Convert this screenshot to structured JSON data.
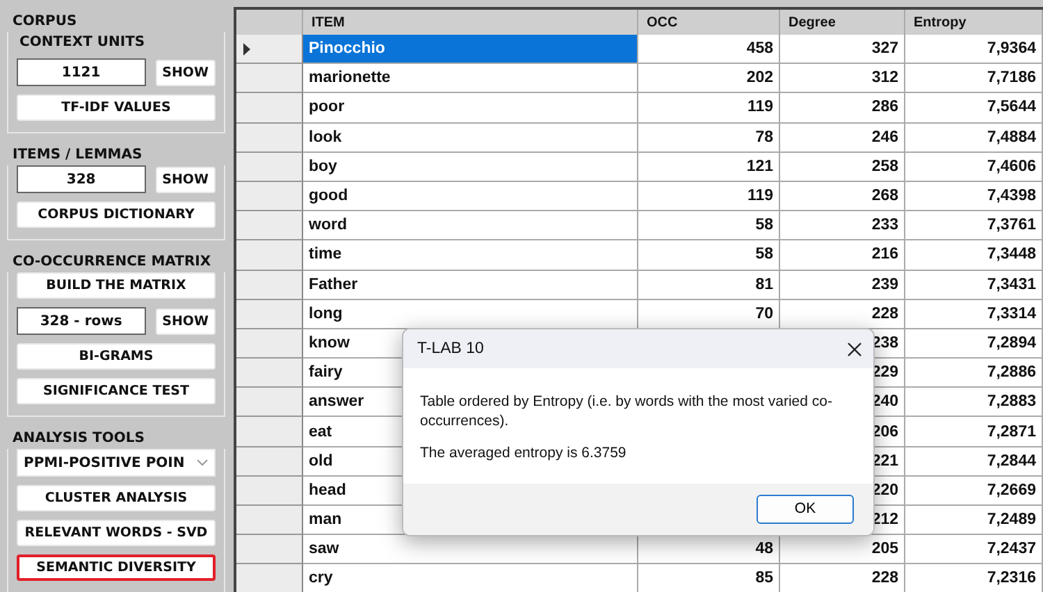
{
  "sidebar": {
    "sections": [
      {
        "title": "CORPUS",
        "controls": [
          {
            "kind": "label",
            "text": "CONTEXT UNITS"
          },
          {
            "kind": "field_show",
            "value": "1121",
            "button": "SHOW"
          },
          {
            "kind": "button",
            "label": "TF-IDF VALUES",
            "highlighted": false
          }
        ]
      },
      {
        "title": "ITEMS / LEMMAS",
        "controls": [
          {
            "kind": "field_show",
            "value": "328",
            "button": "SHOW"
          },
          {
            "kind": "button",
            "label": "CORPUS DICTIONARY",
            "highlighted": false
          }
        ]
      },
      {
        "title": "CO-OCCURRENCE MATRIX",
        "controls": [
          {
            "kind": "button",
            "label": "BUILD THE MATRIX",
            "highlighted": false
          },
          {
            "kind": "field_show",
            "value": "328 - rows",
            "button": "SHOW"
          },
          {
            "kind": "button",
            "label": "BI-GRAMS",
            "highlighted": false
          },
          {
            "kind": "button",
            "label": "SIGNIFICANCE TEST",
            "highlighted": false
          }
        ]
      },
      {
        "title": "ANALYSIS TOOLS",
        "controls": [
          {
            "kind": "select",
            "value": "PPMI-POSITIVE POIN"
          },
          {
            "kind": "button",
            "label": "CLUSTER ANALYSIS",
            "highlighted": false
          },
          {
            "kind": "button",
            "label": "RELEVANT WORDS - SVD",
            "highlighted": false
          },
          {
            "kind": "button",
            "label": "SEMANTIC DIVERSITY",
            "highlighted": true
          }
        ]
      }
    ]
  },
  "table": {
    "columns": [
      "ITEM",
      "OCC",
      "Degree",
      "Entropy"
    ],
    "rows": [
      {
        "item": "Pinocchio",
        "occ": "458",
        "degree": "327",
        "entropy": "7,9364",
        "selected": true
      },
      {
        "item": "marionette",
        "occ": "202",
        "degree": "312",
        "entropy": "7,7186",
        "selected": false
      },
      {
        "item": "poor",
        "occ": "119",
        "degree": "286",
        "entropy": "7,5644",
        "selected": false
      },
      {
        "item": "look",
        "occ": "78",
        "degree": "246",
        "entropy": "7,4884",
        "selected": false
      },
      {
        "item": "boy",
        "occ": "121",
        "degree": "258",
        "entropy": "7,4606",
        "selected": false
      },
      {
        "item": "good",
        "occ": "119",
        "degree": "268",
        "entropy": "7,4398",
        "selected": false
      },
      {
        "item": "word",
        "occ": "58",
        "degree": "233",
        "entropy": "7,3761",
        "selected": false
      },
      {
        "item": "time",
        "occ": "58",
        "degree": "216",
        "entropy": "7,3448",
        "selected": false
      },
      {
        "item": "Father",
        "occ": "81",
        "degree": "239",
        "entropy": "7,3431",
        "selected": false
      },
      {
        "item": "long",
        "occ": "70",
        "degree": "228",
        "entropy": "7,3314",
        "selected": false
      },
      {
        "item": "know",
        "degree": "238",
        "entropy": "7,2894",
        "selected": false
      },
      {
        "item": "fairy",
        "degree": "229",
        "entropy": "7,2886",
        "selected": false
      },
      {
        "item": "answer",
        "degree": "240",
        "entropy": "7,2883",
        "selected": false
      },
      {
        "item": "eat",
        "degree": "206",
        "entropy": "7,2871",
        "selected": false
      },
      {
        "item": "old",
        "degree": "221",
        "entropy": "7,2844",
        "selected": false
      },
      {
        "item": "head",
        "degree": "220",
        "entropy": "7,2669",
        "selected": false
      },
      {
        "item": "man",
        "degree": "212",
        "entropy": "7,2489",
        "selected": false
      },
      {
        "item": "saw",
        "occ": "48",
        "degree": "205",
        "entropy": "7,2437",
        "selected": false
      },
      {
        "item": "cry",
        "occ": "85",
        "degree": "228",
        "entropy": "7,2316",
        "selected": false
      }
    ]
  },
  "dialog": {
    "title": "T-LAB 10",
    "messages": [
      "Table ordered by Entropy (i.e. by words with the most varied co-occurrences).",
      "The averaged entropy is  6.3759"
    ],
    "button": "OK"
  }
}
